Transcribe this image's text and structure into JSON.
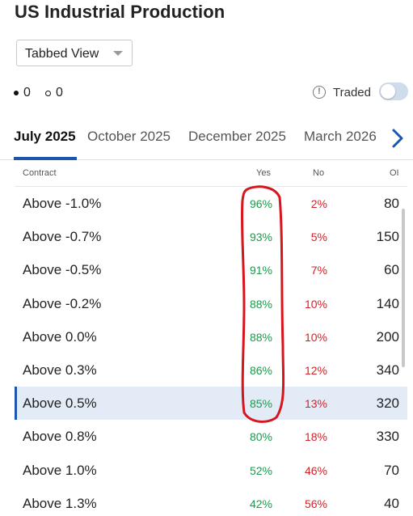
{
  "page": {
    "title": "US Industrial Production"
  },
  "view_select": {
    "value": "Tabbed View"
  },
  "counters": [
    {
      "icon": "dot-filled-icon",
      "value": "0"
    },
    {
      "icon": "dot-hollow-icon",
      "value": "0"
    }
  ],
  "traded_toggle": {
    "icon": "info-icon",
    "label": "Traded",
    "state": "off"
  },
  "tabs": [
    {
      "label": "July 2025",
      "active": true
    },
    {
      "label": "October 2025",
      "active": false
    },
    {
      "label": "December 2025",
      "active": false
    },
    {
      "label": "March 2026",
      "active": false
    }
  ],
  "table": {
    "headers": {
      "contract": "Contract",
      "yes": "Yes",
      "no": "No",
      "oi": "OI"
    },
    "rows": [
      {
        "contract": "Above -1.0%",
        "yes": "96%",
        "no": "2%",
        "oi": "80"
      },
      {
        "contract": "Above -0.7%",
        "yes": "93%",
        "no": "5%",
        "oi": "150"
      },
      {
        "contract": "Above -0.5%",
        "yes": "91%",
        "no": "7%",
        "oi": "60"
      },
      {
        "contract": "Above -0.2%",
        "yes": "88%",
        "no": "10%",
        "oi": "140"
      },
      {
        "contract": "Above 0.0%",
        "yes": "88%",
        "no": "10%",
        "oi": "200"
      },
      {
        "contract": "Above 0.3%",
        "yes": "86%",
        "no": "12%",
        "oi": "340"
      },
      {
        "contract": "Above 0.5%",
        "yes": "85%",
        "no": "13%",
        "oi": "320",
        "selected": true
      },
      {
        "contract": "Above 0.8%",
        "yes": "80%",
        "no": "18%",
        "oi": "330"
      },
      {
        "contract": "Above 1.0%",
        "yes": "52%",
        "no": "46%",
        "oi": "70"
      },
      {
        "contract": "Above 1.3%",
        "yes": "42%",
        "no": "56%",
        "oi": "40"
      }
    ]
  },
  "colors": {
    "accent": "#1a56b0",
    "yes": "#1a9a4a",
    "no": "#d2232a",
    "annotation": "#d8141c",
    "selected_row": "#e3ebf7"
  }
}
